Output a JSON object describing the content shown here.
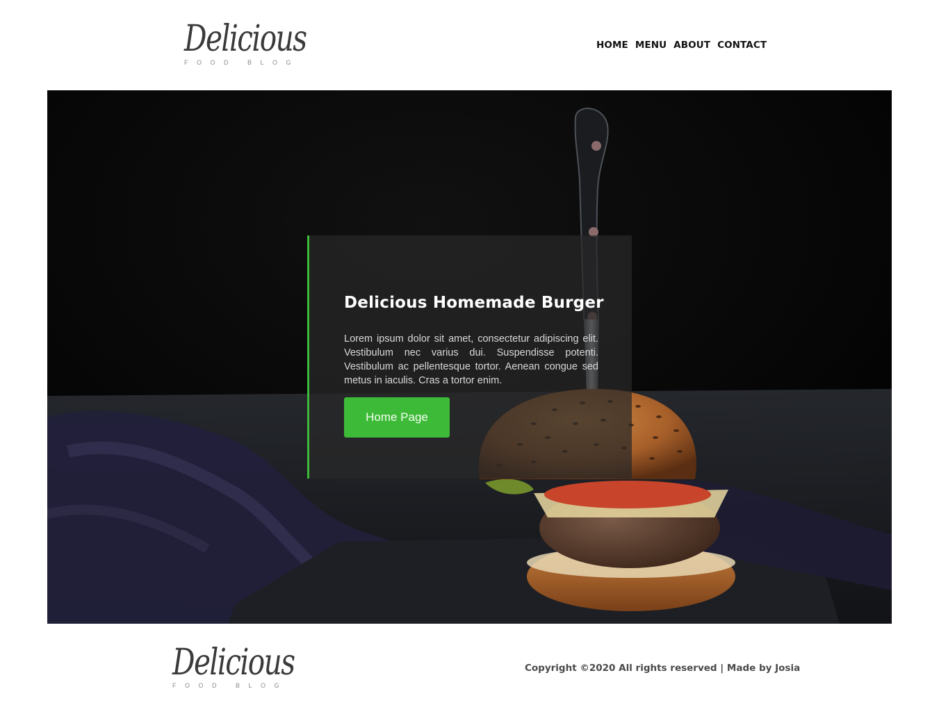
{
  "header": {
    "logo_script": "Delicious",
    "logo_sub": "FOOD BLOG",
    "nav": [
      "HOME",
      "MENU",
      "ABOUT",
      "CONTACT"
    ]
  },
  "hero": {
    "title": "Delicious Homemade Burger",
    "text": "Lorem ipsum dolor sit amet, consectetur adipiscing elit. Vestibulum nec varius dui. Suspendisse potenti. Vestibulum ac pellentesque tortor. Aenean congue sed metus in iaculis. Cras a tortor enim.",
    "button_label": "Home Page",
    "accent_color": "#3dba38"
  },
  "footer": {
    "logo_script": "Delicious",
    "logo_sub": "FOOD BLOG",
    "copyright": "Copyright ©2020 All rights reserved | Made by Josia"
  }
}
